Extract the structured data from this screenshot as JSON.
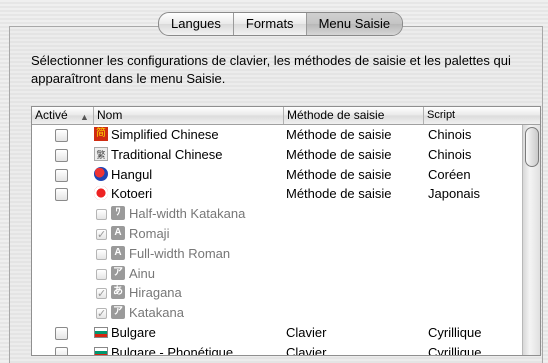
{
  "tabs": [
    "Langues",
    "Formats",
    "Menu Saisie"
  ],
  "active_tab": "Menu Saisie",
  "description": "Sélectionner les configurations de clavier, les méthodes de saisie et les palettes qui apparaîtront dans le menu Saisie.",
  "table": {
    "headers": {
      "active": "Activé",
      "name": "Nom",
      "method": "Méthode de saisie",
      "script": "Script"
    },
    "rows": [
      {
        "name": "Simplified Chinese",
        "method": "Méthode de saisie",
        "script": "Chinois",
        "checked": false,
        "icon": "chinese-simplified-icon",
        "sub": false
      },
      {
        "name": "Traditional Chinese",
        "method": "Méthode de saisie",
        "script": "Chinois",
        "checked": false,
        "icon": "chinese-traditional-icon",
        "sub": false
      },
      {
        "name": "Hangul",
        "method": "Méthode de saisie",
        "script": "Coréen",
        "checked": false,
        "icon": "hangul-icon",
        "sub": false
      },
      {
        "name": "Kotoeri",
        "method": "Méthode de saisie",
        "script": "Japonais",
        "checked": false,
        "icon": "kotoeri-icon",
        "sub": false
      },
      {
        "name": "Half-width Katakana",
        "method": "",
        "script": "",
        "checked": false,
        "icon": "half-width-katakana-icon",
        "glyph": "ﾜ",
        "sub": true
      },
      {
        "name": "Romaji",
        "method": "",
        "script": "",
        "checked": true,
        "icon": "romaji-icon",
        "glyph": "A",
        "sub": true
      },
      {
        "name": "Full-width Roman",
        "method": "",
        "script": "",
        "checked": false,
        "icon": "full-width-roman-icon",
        "glyph": "A",
        "sub": true
      },
      {
        "name": "Ainu",
        "method": "",
        "script": "",
        "checked": false,
        "icon": "ainu-icon",
        "glyph": "ア",
        "sub": true
      },
      {
        "name": "Hiragana",
        "method": "",
        "script": "",
        "checked": true,
        "icon": "hiragana-icon",
        "glyph": "あ",
        "sub": true
      },
      {
        "name": "Katakana",
        "method": "",
        "script": "",
        "checked": true,
        "icon": "katakana-icon",
        "glyph": "ア",
        "sub": true
      },
      {
        "name": "Bulgare",
        "method": "Clavier",
        "script": "Cyrillique",
        "checked": false,
        "icon": "bulgarian-flag-icon",
        "sub": false
      },
      {
        "name": "Bulgare - Phonétique",
        "method": "Clavier",
        "script": "Cyrillique",
        "checked": false,
        "icon": "bulgarian-flag-icon",
        "sub": false
      }
    ]
  }
}
